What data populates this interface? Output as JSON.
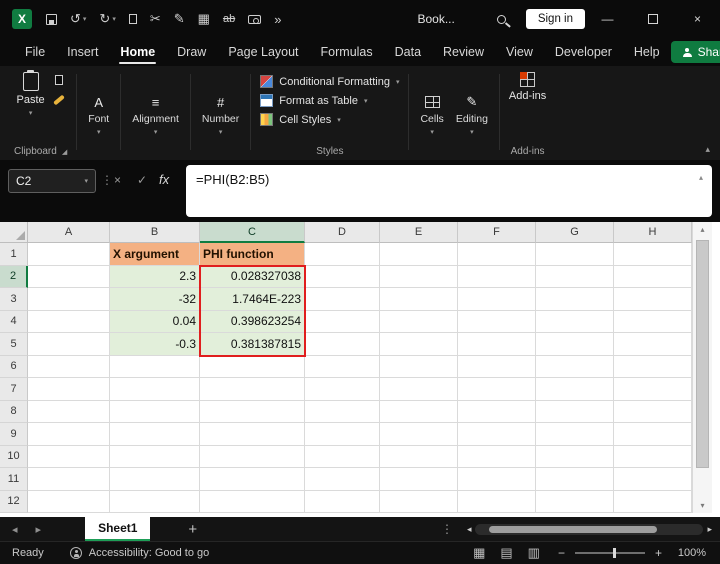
{
  "icons": {
    "excel_logo": "X",
    "undo": "↺",
    "redo": "↻",
    "chevron_down": "▾",
    "chevron_up": "▴",
    "cut": "✂",
    "draw": "✎",
    "table": "▦",
    "strikethrough": "ab",
    "more": "»",
    "minimize": "—",
    "close": "×",
    "dots": "⋮",
    "cancel": "×",
    "confirm": "✓",
    "fx": "fx",
    "dialog_launcher": "◢",
    "font": "A",
    "alignment": "≡",
    "number": "#",
    "editing": "✎",
    "nav_left": "◂",
    "nav_right": "▸",
    "plus": "+",
    "scroll_up": "▴",
    "scroll_down": "▾",
    "scroll_left": "◂",
    "scroll_right": "▸",
    "view_normal": "▦",
    "view_layout": "▤",
    "view_break": "▥",
    "zoom_out": "−",
    "zoom_in": "+"
  },
  "titlebar": {
    "document_name": "Book...",
    "sign_in_label": "Sign in"
  },
  "tabs": {
    "items": [
      "File",
      "Insert",
      "Home",
      "Draw",
      "Page Layout",
      "Formulas",
      "Data",
      "Review",
      "View",
      "Developer",
      "Help"
    ],
    "active": "Home",
    "share_label": "Share"
  },
  "ribbon": {
    "paste": "Paste",
    "clipboard": "Clipboard",
    "font": "Font",
    "alignment": "Alignment",
    "number": "Number",
    "conditional_formatting": "Conditional Formatting",
    "format_as_table": "Format as Table",
    "cell_styles": "Cell Styles",
    "styles": "Styles",
    "cells": "Cells",
    "editing": "Editing",
    "addins": "Add-ins",
    "addins_group": "Add-ins"
  },
  "formula_bar": {
    "name_box_value": "C2",
    "formula": "=PHI(B2:B5)"
  },
  "grid": {
    "column_headers": [
      "A",
      "B",
      "C",
      "D",
      "E",
      "F",
      "G",
      "H"
    ],
    "row_headers": [
      "1",
      "2",
      "3",
      "4",
      "5",
      "6",
      "7",
      "8",
      "9",
      "10",
      "11",
      "12"
    ],
    "selected_column": "C",
    "selected_row": "2",
    "cells": {
      "B1": "X argument",
      "C1": "PHI function",
      "B2": "2.3",
      "C2": "0.028327038",
      "B3": "-32",
      "C3": "1.7464E-223",
      "B4": "0.04",
      "C4": "0.398623254",
      "B5": "-0.3",
      "C5": "0.381387815"
    }
  },
  "sheet_bar": {
    "sheet_name": "Sheet1"
  },
  "status_bar": {
    "ready_label": "Ready",
    "accessibility_label": "Accessibility: Good to go",
    "zoom_value": "100%"
  }
}
